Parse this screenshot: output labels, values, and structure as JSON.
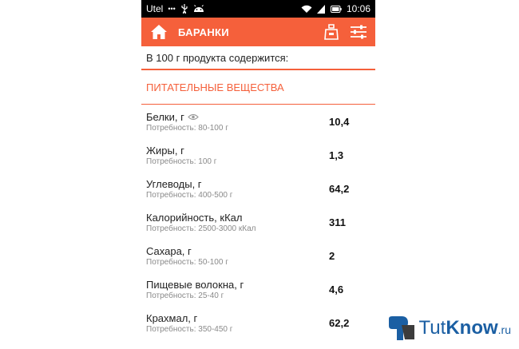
{
  "statusbar": {
    "carrier": "Utel",
    "signal_dots": "•••",
    "time": "10:06"
  },
  "appbar": {
    "title": "БАРАНКИ"
  },
  "intro": "В 100 г продукта содержится:",
  "section_title": "ПИТАТЕЛЬНЫЕ ВЕЩЕСТВА",
  "nutrients": [
    {
      "name": "Белки, г",
      "need": "Потребность: 80-100 г",
      "value": "10,4"
    },
    {
      "name": "Жиры, г",
      "need": "Потребность: 100 г",
      "value": "1,3"
    },
    {
      "name": "Углеводы, г",
      "need": "Потребность: 400-500 г",
      "value": "64,2"
    },
    {
      "name": "Калорийность, кКал",
      "need": "Потребность: 2500-3000 кКал",
      "value": "311"
    },
    {
      "name": "Сахара, г",
      "need": "Потребность: 50-100 г",
      "value": "2"
    },
    {
      "name": "Пищевые волокна, г",
      "need": "Потребность: 25-40 г",
      "value": "4,6"
    },
    {
      "name": "Крахмал, г",
      "need": "Потребность: 350-450 г",
      "value": "62,2"
    }
  ],
  "watermark": {
    "part1": "Tut",
    "part2": "Know",
    "part3": ".ru"
  },
  "colors": {
    "accent": "#f5603b",
    "watermark": "#1b5fa3"
  }
}
